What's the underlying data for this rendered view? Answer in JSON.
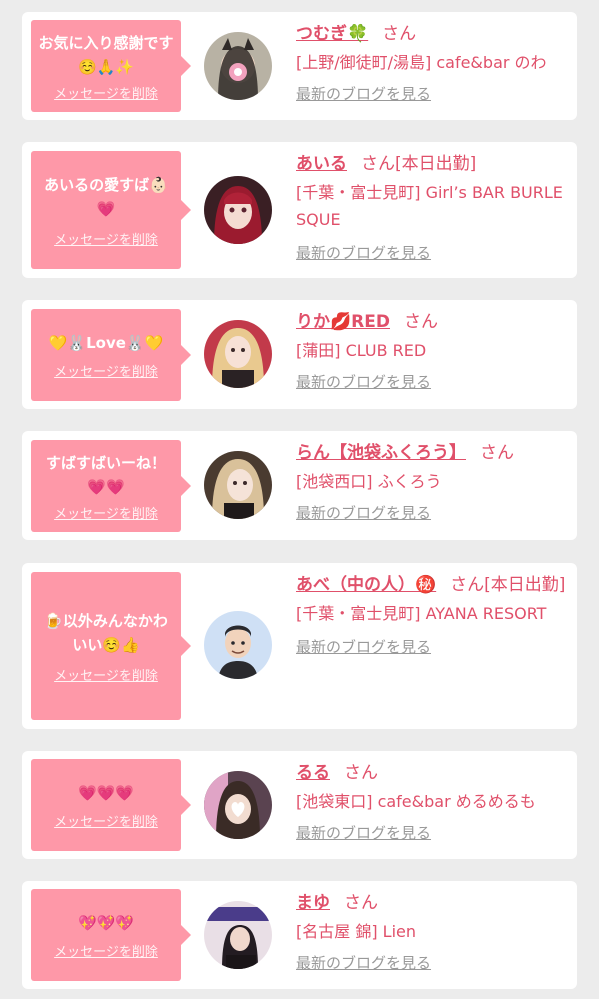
{
  "items": [
    {
      "message": "お気に入り感謝です☺️🙏✨",
      "delete_label": "メッセージを削除",
      "cast_name": "つむぎ🍀",
      "honorific": "さん",
      "status": "",
      "shop": "[上野/御徒町/湯島] cafe&bar のわ",
      "blog_label": "最新のブログを見る",
      "avatar_icon": "girl-with-cat-ears-avatar"
    },
    {
      "message": "あいるの愛すば👶🏻💗",
      "delete_label": "メッセージを削除",
      "cast_name": "あいる",
      "honorific": "さん",
      "status": "[本日出勤]",
      "shop": "[千葉・富士見町] Girl’s BAR BURLESQUE",
      "blog_label": "最新のブログを見る",
      "avatar_icon": "girl-red-hair-avatar"
    },
    {
      "message": "💛🐰Love🐰💛",
      "delete_label": "メッセージを削除",
      "cast_name": "りか💋RED",
      "honorific": "さん",
      "status": "",
      "shop": "[蒲田] CLUB RED",
      "blog_label": "最新のブログを見る",
      "avatar_icon": "girl-blonde-avatar"
    },
    {
      "message": "すばすばいーね！💗💗",
      "delete_label": "メッセージを削除",
      "cast_name": "らん【池袋ふくろう】",
      "honorific": "さん",
      "status": "",
      "shop": "[池袋西口] ふくろう",
      "blog_label": "最新のブログを見る",
      "avatar_icon": "girl-light-hair-avatar"
    },
    {
      "message": "🍺以外みんなかわいい☺️👍",
      "delete_label": "メッセージを削除",
      "cast_name": "あべ（中の人）㊙️",
      "honorific": "さん",
      "status": "[本日出勤]",
      "shop": "[千葉・富士見町] AYANA RESORT",
      "blog_label": "最新のブログを見る",
      "avatar_icon": "man-cartoon-avatar"
    },
    {
      "message": "💗💗💗",
      "delete_label": "メッセージを削除",
      "cast_name": "るる",
      "honorific": "さん",
      "status": "",
      "shop": "[池袋東口] cafe&bar めるめるも",
      "blog_label": "最新のブログを見る",
      "avatar_icon": "girl-heart-face-avatar"
    },
    {
      "message": "💖💖💖",
      "delete_label": "メッセージを削除",
      "cast_name": "まゆ",
      "honorific": "さん",
      "status": "",
      "shop": "[名古屋 錦] Lien",
      "blog_label": "最新のブログを見る",
      "avatar_icon": "girl-lien-logo-avatar"
    }
  ],
  "colors": {
    "background": "#ececec",
    "card": "#ffffff",
    "bubble": "#fe98a8",
    "accent_text": "#e0506a",
    "muted_link": "#999999"
  }
}
